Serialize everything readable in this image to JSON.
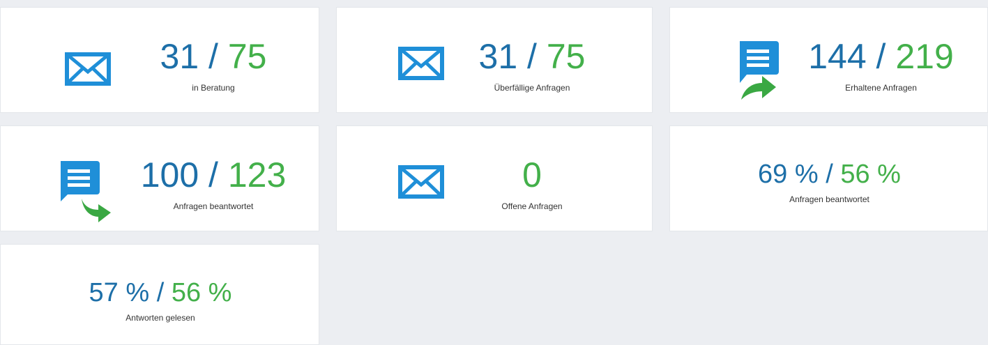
{
  "colors": {
    "primary": "#1d6fa8",
    "secondary": "#43b04a",
    "icon_blue": "#1f8fd8",
    "arrow_green": "#3aa843",
    "card_bg": "#ffffff",
    "page_bg": "#eceef2"
  },
  "tiles": [
    {
      "icon": "envelope-icon",
      "value_a": "31",
      "separator": "/",
      "value_b": "75",
      "label": "in Beratung"
    },
    {
      "icon": "envelope-icon",
      "value_a": "31",
      "separator": "/",
      "value_b": "75",
      "label": "Überfällige Anfragen"
    },
    {
      "icon": "message-forward-icon",
      "value_a": "144",
      "separator": "/",
      "value_b": "219",
      "label": "Erhaltene Anfragen"
    },
    {
      "icon": "message-forward-icon",
      "value_a": "100",
      "separator": "/",
      "value_b": "123",
      "label": "Anfragen beantwortet"
    },
    {
      "icon": "envelope-icon",
      "value_a": "0",
      "label": "Offene Anfragen"
    },
    {
      "value_a": "69 %",
      "separator": "/",
      "value_b": "56 %",
      "label": "Anfragen beantwortet"
    },
    {
      "value_a": "57 %",
      "separator": "/",
      "value_b": "56 %",
      "label": "Antworten gelesen"
    }
  ]
}
